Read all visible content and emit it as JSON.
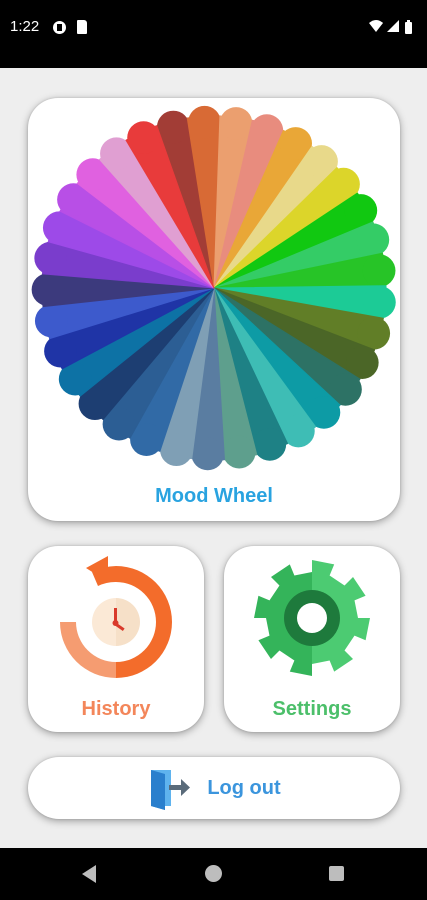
{
  "status_bar": {
    "time": "1:22",
    "icons": [
      "app-notification-icon",
      "sd-card-icon",
      "wifi-icon",
      "cell-signal-icon",
      "battery-icon"
    ]
  },
  "mood_wheel": {
    "label": "Mood Wheel",
    "label_color": "#29a3e0",
    "segment_colors": [
      "#a23d36",
      "#d86a35",
      "#eb9f6f",
      "#e88c7e",
      "#e9a737",
      "#e8d98a",
      "#dcd52a",
      "#11c811",
      "#34cc66",
      "#27c427",
      "#1ccb96",
      "#617e27",
      "#4b6627",
      "#2d7265",
      "#0d9ba5",
      "#3ebdb5",
      "#1e8185",
      "#5e9f8d",
      "#5a7da1",
      "#7f9fb5",
      "#316aa6",
      "#2c5e94",
      "#1d3e72",
      "#0d72a5",
      "#1f34a6",
      "#3d5acc",
      "#3c3a7d",
      "#7a3dcc",
      "#9d4ae8",
      "#b84fe6",
      "#e061e0",
      "#e09fd2",
      "#e83b3b"
    ]
  },
  "history": {
    "label": "History",
    "label_color": "#f3865a",
    "icon": "history-icon"
  },
  "settings": {
    "label": "Settings",
    "label_color": "#4cbf6a",
    "icon": "gear-icon"
  },
  "logout": {
    "label": "Log out",
    "label_color": "#3b95dd",
    "icon": "logout-door-icon"
  },
  "nav_bar": {
    "icons": [
      "back-icon",
      "home-icon",
      "recents-icon"
    ]
  }
}
